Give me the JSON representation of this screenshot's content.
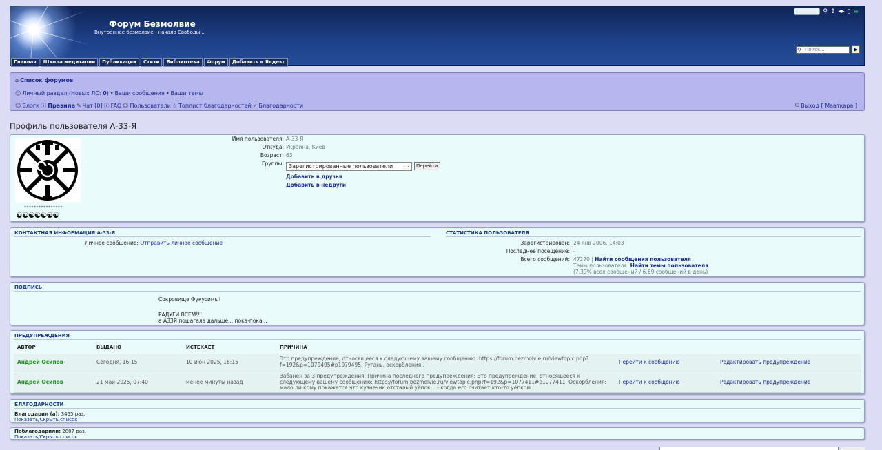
{
  "header": {
    "title": "Форум Безмолвие",
    "description": "Внутреннее безмолвие - начало Свободы...",
    "search_placeholder": "Поиск...",
    "nav": [
      "Главная",
      "Школа медитации",
      "Публикации",
      "Стихи",
      "Библиотека",
      "Форум",
      "Добавить в Яндекс"
    ]
  },
  "navbar": {
    "forum_list": "Список форумов",
    "personal_section": "Личный раздел (Новых ЛС: ",
    "new_pm_count": "0",
    "personal_close": ")",
    "your_posts": "Ваши сообщения",
    "your_topics": "Ваши темы",
    "bullet": "•",
    "blogs": "Блоги",
    "rules": "Правила",
    "chat": "Чат [0]",
    "faq": "FAQ",
    "users": "Пользователи",
    "toplist": "Топлист благодарностей",
    "thanks": "Благодарности",
    "logout": "Выход [ Мааткара ]"
  },
  "page_title": "Профиль пользователя А-33-Я",
  "profile": {
    "avatar_stars": "****************",
    "avatar_yinyang": "☯☯☯☯☯☯☯",
    "fields": [
      {
        "label": "Имя пользователя:",
        "value": "А-33-Я"
      },
      {
        "label": "Откуда:",
        "value": "Украина, Киев"
      },
      {
        "label": "Возраст:",
        "value": "63"
      }
    ],
    "groups_label": "Группы:",
    "groups_selected": "Зарегистрированные пользователи",
    "groups_go": "Перейти",
    "add_friend": "Добавить в друзья",
    "add_foe": "Добавить в недруги"
  },
  "contact": {
    "title": "Контактная информация А-33-Я",
    "pm_label": "Личное сообщение:",
    "pm_link": "Отправить личное сообщение"
  },
  "stats": {
    "title": "Статистика пользователя",
    "registered_label": "Зарегистрирован:",
    "registered_value": "24 янв 2006, 14:03",
    "last_visit_label": "Последнее посещение:",
    "last_visit_value": "-",
    "total_posts_label": "Всего сообщений:",
    "total_posts_value": "47270",
    "sep": "|",
    "find_posts": "Найти сообщения пользователя",
    "topics_label": "Темы пользователя:",
    "find_topics": "Найти темы пользователя",
    "posts_share": "(7.39% всех сообщений / 6.69 сообщений в день)"
  },
  "signature": {
    "title": "Подпись",
    "line1": "Сокровище Фукусимы!",
    "line2": "РАДУГИ ВСЕМ!!!",
    "line3": "а АЗЗЯ пошагала дальше... пока-пока..."
  },
  "warnings": {
    "title": "Предупреждения",
    "columns": [
      "Автор",
      "Выдано",
      "Истекает",
      "Причина"
    ],
    "rows": [
      {
        "author": "Андрей Осипов",
        "issued": "Сегодня, 16:15",
        "expires": "10 июн 2025, 16:15",
        "reason": "Это предупреждение, относящееся к следующему вашему сообщению: https://forum.bezmolvie.ru/viewtopic.php?f=192&p=1079495#p1079495. Ругань, оскорбления,.",
        "goto": "Перейти к сообщению",
        "edit": "Редактировать предупреждение"
      },
      {
        "author": "Андрей Осипов",
        "issued": "21 май 2025, 07:40",
        "expires": "менее минуты назад",
        "reason": "Забанен за 3 предупреждения. Причина последнего предупреждения: Это предупреждение, относящееся к следующему вашему сообщению: https://forum.bezmolvie.ru/viewtopic.php?f=192&p=1077411#p1077411. Оскорбления: мало ли кому покажется что кузнечик отсталый уёпок... - когда его считает кто-то уёпком",
        "goto": "Перейти к сообщению",
        "edit": "Редактировать предупреждение"
      }
    ]
  },
  "thanks": {
    "title": "Благодарности",
    "gave_label": "Благодарил (а):",
    "gave_value": "3455 раз.",
    "toggle": "Показать/Скрыть список",
    "received_label": "Поблагодарили:",
    "received_value": "2807 раз."
  }
}
